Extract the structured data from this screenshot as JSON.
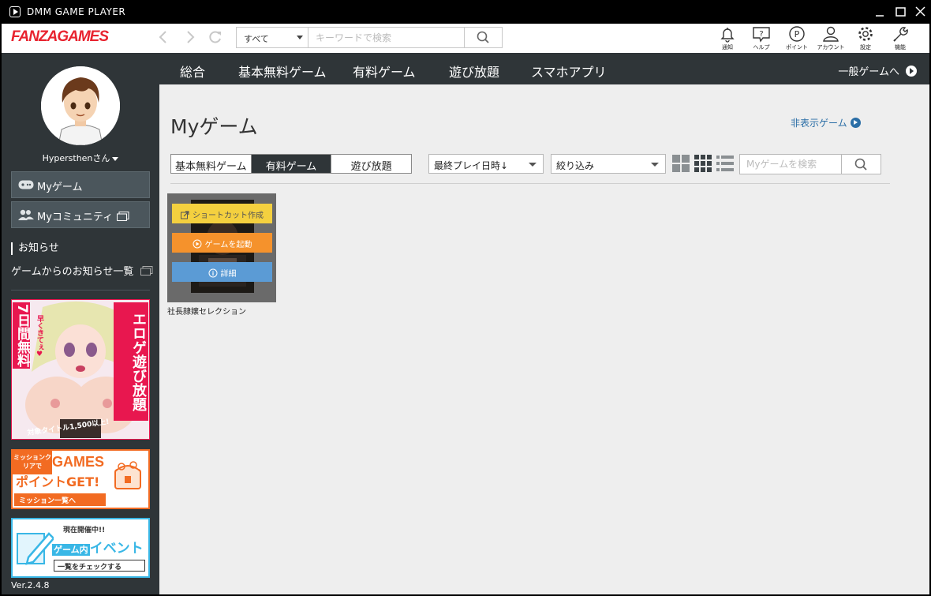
{
  "window": {
    "title": "DMM GAME PLAYER"
  },
  "header": {
    "brand": "FANZAGAMES",
    "search": {
      "category": "すべて",
      "placeholder": "キーワードで検索"
    },
    "icons": [
      {
        "name": "bell-icon",
        "label": "通知"
      },
      {
        "name": "help-icon",
        "label": "ヘルプ"
      },
      {
        "name": "point-icon",
        "label": "ポイント"
      },
      {
        "name": "account-icon",
        "label": "アカウント"
      },
      {
        "name": "settings-icon",
        "label": "設定"
      },
      {
        "name": "wrench-icon",
        "label": "機能"
      }
    ]
  },
  "sidebar": {
    "username": "Hypersthenさん",
    "my_game": "Myゲーム",
    "my_community": "Myコミュニティ",
    "notice_title": "お知らせ",
    "notice_link": "ゲームからのお知らせ一覧",
    "banner1": {
      "left": "7日間無料",
      "right": "エロゲ遊び放題",
      "tag": "早くきてぇ♥",
      "bottom": "対象タイトル1,500以上!"
    },
    "banner2": {
      "small": "ミッションクリアで",
      "big1": "GAMES",
      "big2": "ポイントGET!",
      "link": "ミッション一覧へ"
    },
    "banner3": {
      "top": "現在開催中!!",
      "main1": "ゲーム内",
      "main2": "イベント",
      "link": "一覧をチェックする"
    },
    "version": "Ver.2.4.8"
  },
  "topnav": {
    "tabs": [
      "総合",
      "基本無料ゲーム",
      "有料ゲーム",
      "遊び放題",
      "スマホアプリ"
    ],
    "general": "一般ゲームへ"
  },
  "main": {
    "title": "Myゲーム",
    "hidden_games": "非表示ゲーム",
    "segments": [
      "基本無料ゲーム",
      "有料ゲーム",
      "遊び放題"
    ],
    "active_segment": "有料ゲーム",
    "sort": "最終プレイ日時↓",
    "filter": "絞り込み",
    "search_placeholder": "Myゲームを検索",
    "card": {
      "shortcut": "ショートカット作成",
      "launch": "ゲームを起動",
      "detail": "詳細",
      "title": "社長隷嬢セレクション"
    }
  },
  "colors": {
    "brand_red": "#e8232f",
    "sidebar_bg": "#2f3538",
    "shortcut_yellow": "#f4d03f",
    "launch_orange": "#f5922c",
    "detail_blue": "#5b9bd5"
  }
}
